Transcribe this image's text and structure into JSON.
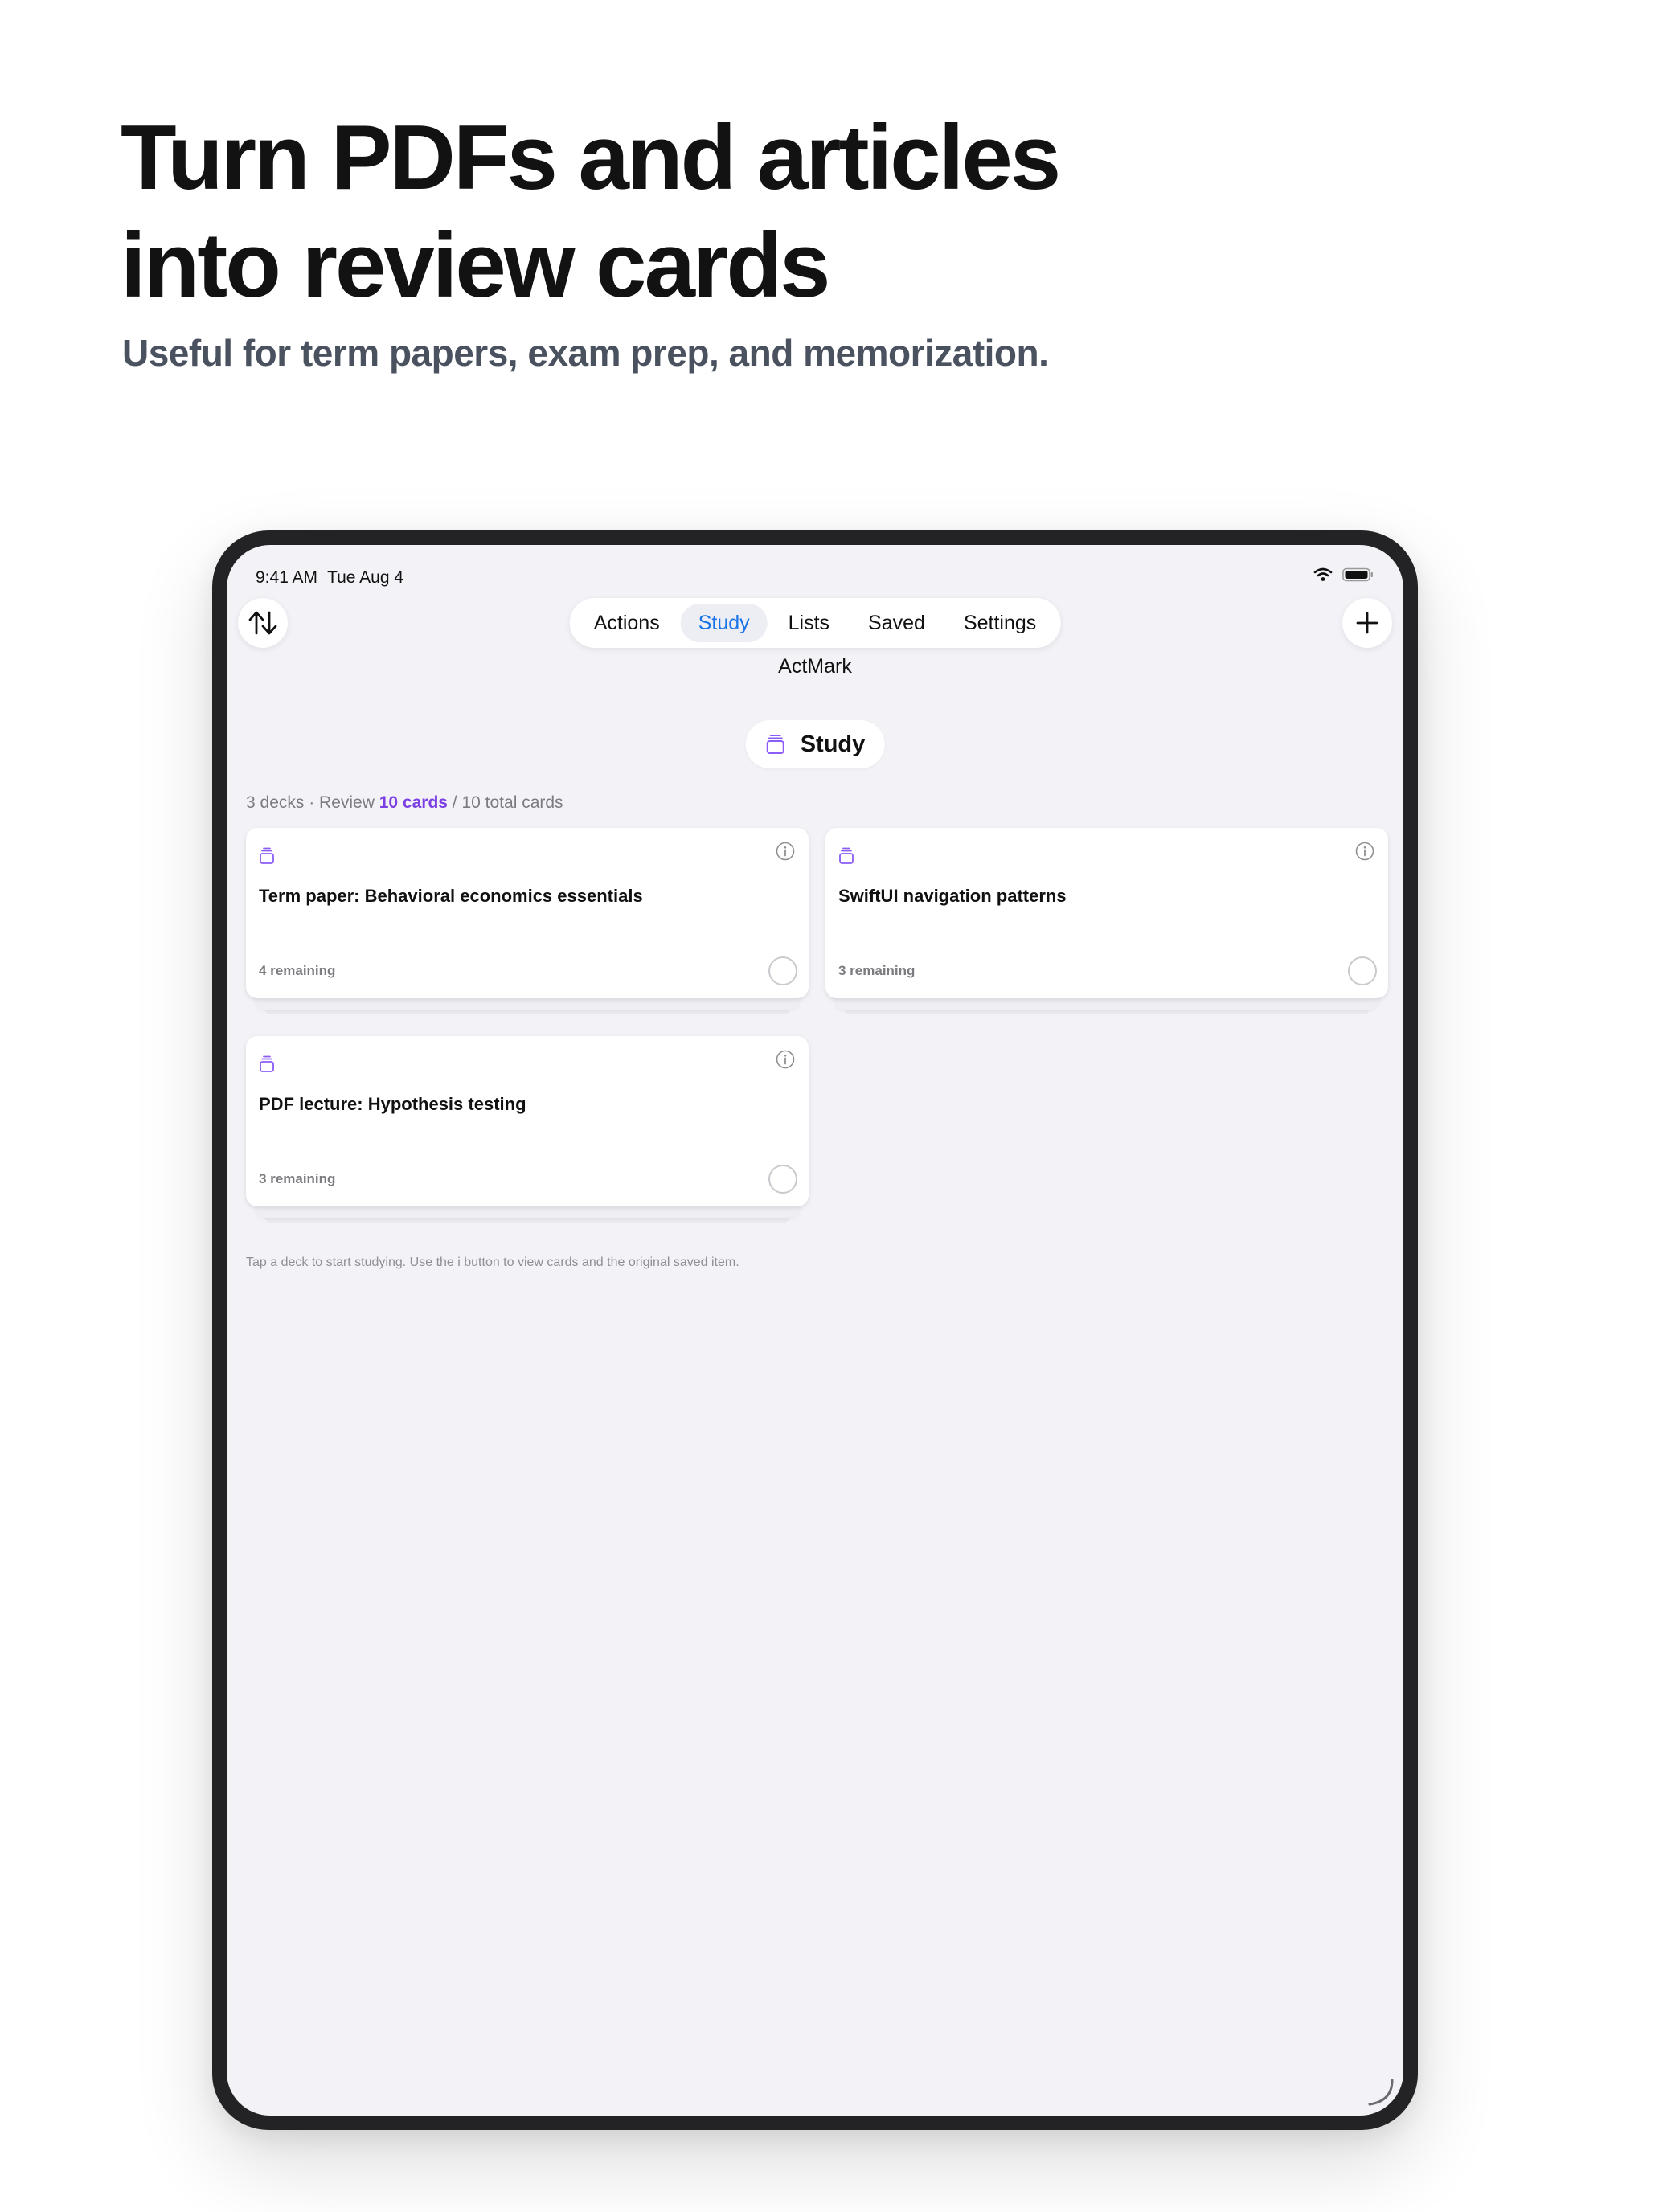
{
  "headline": {
    "line1": "Turn PDFs and articles",
    "line2": "into review cards",
    "subtitle": "Useful for term papers, exam prep, and memorization."
  },
  "statusbar": {
    "time": "9:41 AM",
    "date": "Tue Aug 4",
    "icons": [
      "wifi-icon",
      "battery-icon"
    ]
  },
  "toolbar": {
    "sort_icon": "sort-arrows-icon",
    "add_icon": "plus-icon",
    "tabs": [
      {
        "label": "Actions",
        "active": false
      },
      {
        "label": "Study",
        "active": true
      },
      {
        "label": "Lists",
        "active": false
      },
      {
        "label": "Saved",
        "active": false
      },
      {
        "label": "Settings",
        "active": false
      }
    ]
  },
  "app": {
    "title": "ActMark",
    "section_label": "Study",
    "summary": {
      "prefix": "3 decks · Review ",
      "review_count": "10 cards",
      "suffix": " / 10 total cards"
    },
    "decks": [
      {
        "title": "Term paper: Behavioral economics essentials",
        "remaining": "4 remaining"
      },
      {
        "title": "SwiftUI navigation patterns",
        "remaining": "3 remaining"
      },
      {
        "title": "PDF lecture: Hypothesis testing",
        "remaining": "3 remaining"
      }
    ],
    "hint": "Tap a deck to start studying. Use the i button to view cards and the original saved item."
  },
  "colors": {
    "accent_purple": "#7b3fe4",
    "active_tab": "#1a73e8",
    "background": "#f2f2f7",
    "device_frame": "#232325"
  }
}
